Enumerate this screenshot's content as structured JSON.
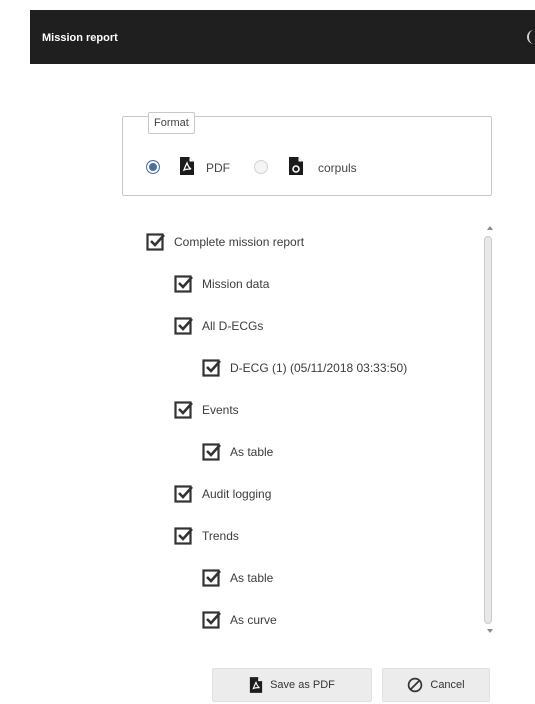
{
  "window": {
    "title": "Mission report"
  },
  "format": {
    "legend": "Format",
    "options": [
      {
        "label": "PDF",
        "icon": "pdf-file-icon",
        "selected": true
      },
      {
        "label": "corpuls",
        "icon": "corpuls-file-icon",
        "selected": false
      }
    ]
  },
  "tree": {
    "items": [
      {
        "label": "Complete mission report",
        "checked": true,
        "level": 0
      },
      {
        "label": "Mission data",
        "checked": true,
        "level": 1
      },
      {
        "label": "All D-ECGs",
        "checked": true,
        "level": 1
      },
      {
        "label": "D-ECG (1) (05/11/2018 03:33:50)",
        "checked": true,
        "level": 2
      },
      {
        "label": "Events",
        "checked": true,
        "level": 1
      },
      {
        "label": "As table",
        "checked": true,
        "level": 2
      },
      {
        "label": "Audit logging",
        "checked": true,
        "level": 1
      },
      {
        "label": "Trends",
        "checked": true,
        "level": 1
      },
      {
        "label": "As table",
        "checked": true,
        "level": 2
      },
      {
        "label": "As curve",
        "checked": true,
        "level": 2
      }
    ]
  },
  "buttons": {
    "save": {
      "label": "Save as PDF",
      "icon": "pdf-file-icon"
    },
    "cancel": {
      "label": "Cancel",
      "icon": "cancel-icon"
    }
  },
  "colors": {
    "titlebar": "#1f1f1f",
    "accent": "#4a6fa5"
  }
}
